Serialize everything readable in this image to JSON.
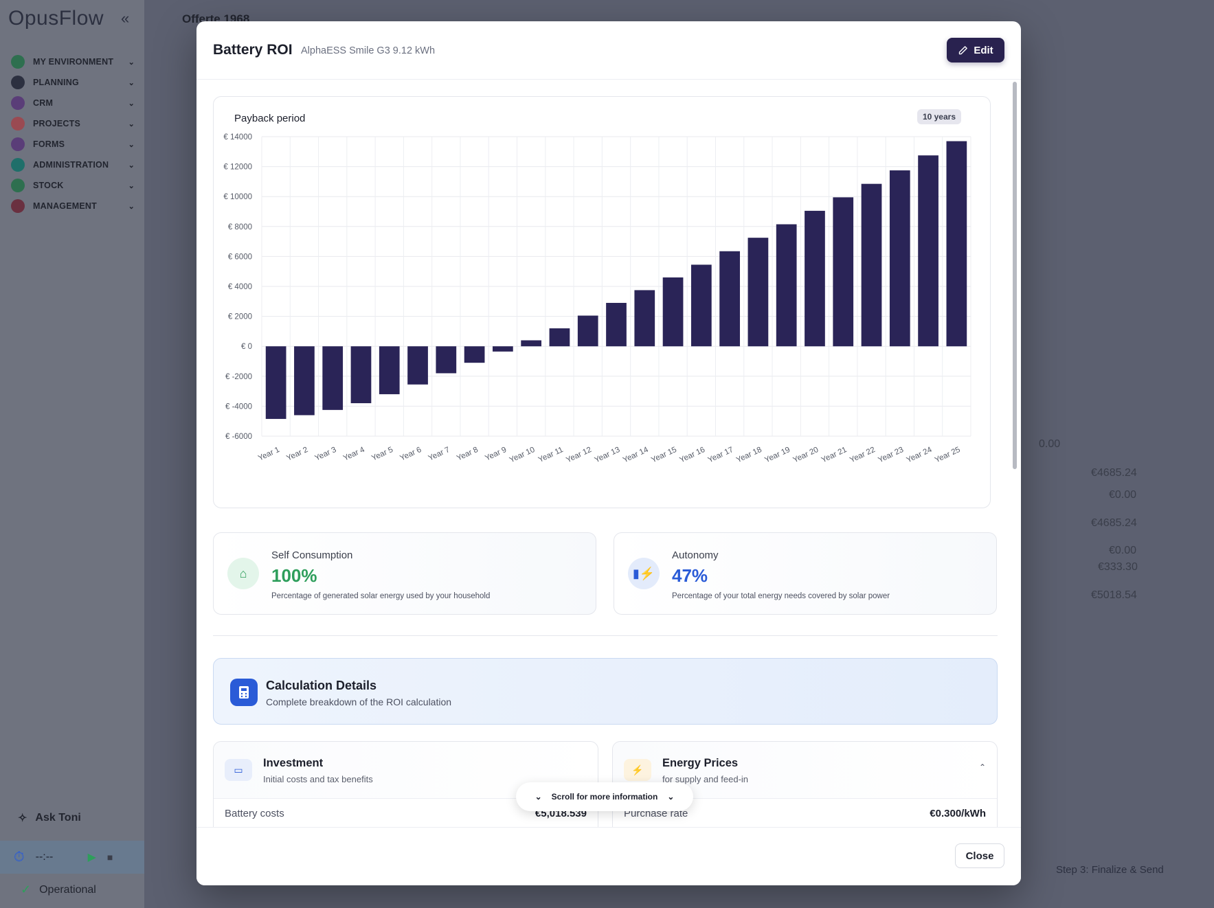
{
  "app": {
    "logo": "OpusFlow",
    "collapse_icon": "«",
    "page_title": "Offerte 1968",
    "nav": [
      {
        "label": "MY ENVIRONMENT",
        "color": "#2e6f4f"
      },
      {
        "label": "PLANNING",
        "color": "#2c3040"
      },
      {
        "label": "CRM",
        "color": "#5a3d78"
      },
      {
        "label": "PROJECTS",
        "color": "#9a4a52"
      },
      {
        "label": "FORMS",
        "color": "#5a3d78"
      },
      {
        "label": "ADMINISTRATION",
        "color": "#1f6f6a"
      },
      {
        "label": "STOCK",
        "color": "#2e6f4f"
      },
      {
        "label": "MANAGEMENT",
        "color": "#6a3040"
      }
    ],
    "ask": "Ask Toni",
    "timer": "--:--",
    "status": "Operational",
    "step": "Step 3: Finalize & Send",
    "bg_values": [
      "0.00",
      "€4685.24",
      "€0.00",
      "€4685.24",
      "€0.00",
      "€333.30",
      "€5018.54"
    ]
  },
  "modal": {
    "title": "Battery ROI",
    "subtitle": "AlphaESS Smile G3 9.12 kWh",
    "edit_label": "Edit",
    "close_label": "Close",
    "chart_title": "Payback period",
    "payback_badge": "10 years",
    "self_consumption": {
      "label": "Self Consumption",
      "value": "100%",
      "desc": "Percentage of generated solar energy used by your household",
      "color": "#2e9e5b"
    },
    "autonomy": {
      "label": "Autonomy",
      "value": "47%",
      "desc": "Percentage of your total energy needs covered by solar power",
      "color": "#2a5bd7"
    },
    "calc": {
      "title": "Calculation Details",
      "subtitle": "Complete breakdown of the ROI calculation"
    },
    "investment": {
      "title": "Investment",
      "subtitle": "Initial costs and tax benefits",
      "row_label": "Battery costs",
      "row_value": "€5,018.539"
    },
    "energy": {
      "title": "Energy Prices",
      "subtitle": "for supply and feed-in",
      "row_label": "Purchase rate",
      "row_value": "€0.300/kWh"
    },
    "scroll_hint": "Scroll for more information"
  },
  "chart_data": {
    "type": "bar",
    "title": "Payback period",
    "categories": [
      "Year 1",
      "Year 2",
      "Year 3",
      "Year 4",
      "Year 5",
      "Year 6",
      "Year 7",
      "Year 8",
      "Year 9",
      "Year 10",
      "Year 11",
      "Year 12",
      "Year 13",
      "Year 14",
      "Year 15",
      "Year 16",
      "Year 17",
      "Year 18",
      "Year 19",
      "Year 20",
      "Year 21",
      "Year 22",
      "Year 23",
      "Year 24",
      "Year 25"
    ],
    "values": [
      -4850,
      -4600,
      -4250,
      -3800,
      -3200,
      -2550,
      -1800,
      -1100,
      -350,
      400,
      1200,
      2050,
      2900,
      3750,
      4600,
      5450,
      6350,
      7250,
      8150,
      9050,
      9950,
      10850,
      11750,
      12750,
      13700
    ],
    "ylim": [
      -6000,
      14000
    ],
    "yticks": [
      -6000,
      -4000,
      -2000,
      0,
      2000,
      4000,
      6000,
      8000,
      10000,
      12000,
      14000
    ],
    "ytick_labels": [
      "€ -6000",
      "€ -4000",
      "€ -2000",
      "€ 0",
      "€ 2000",
      "€ 4000",
      "€ 6000",
      "€ 8000",
      "€ 10000",
      "€ 12000",
      "€ 14000"
    ],
    "bar_color": "#2a2457",
    "grid": true
  }
}
